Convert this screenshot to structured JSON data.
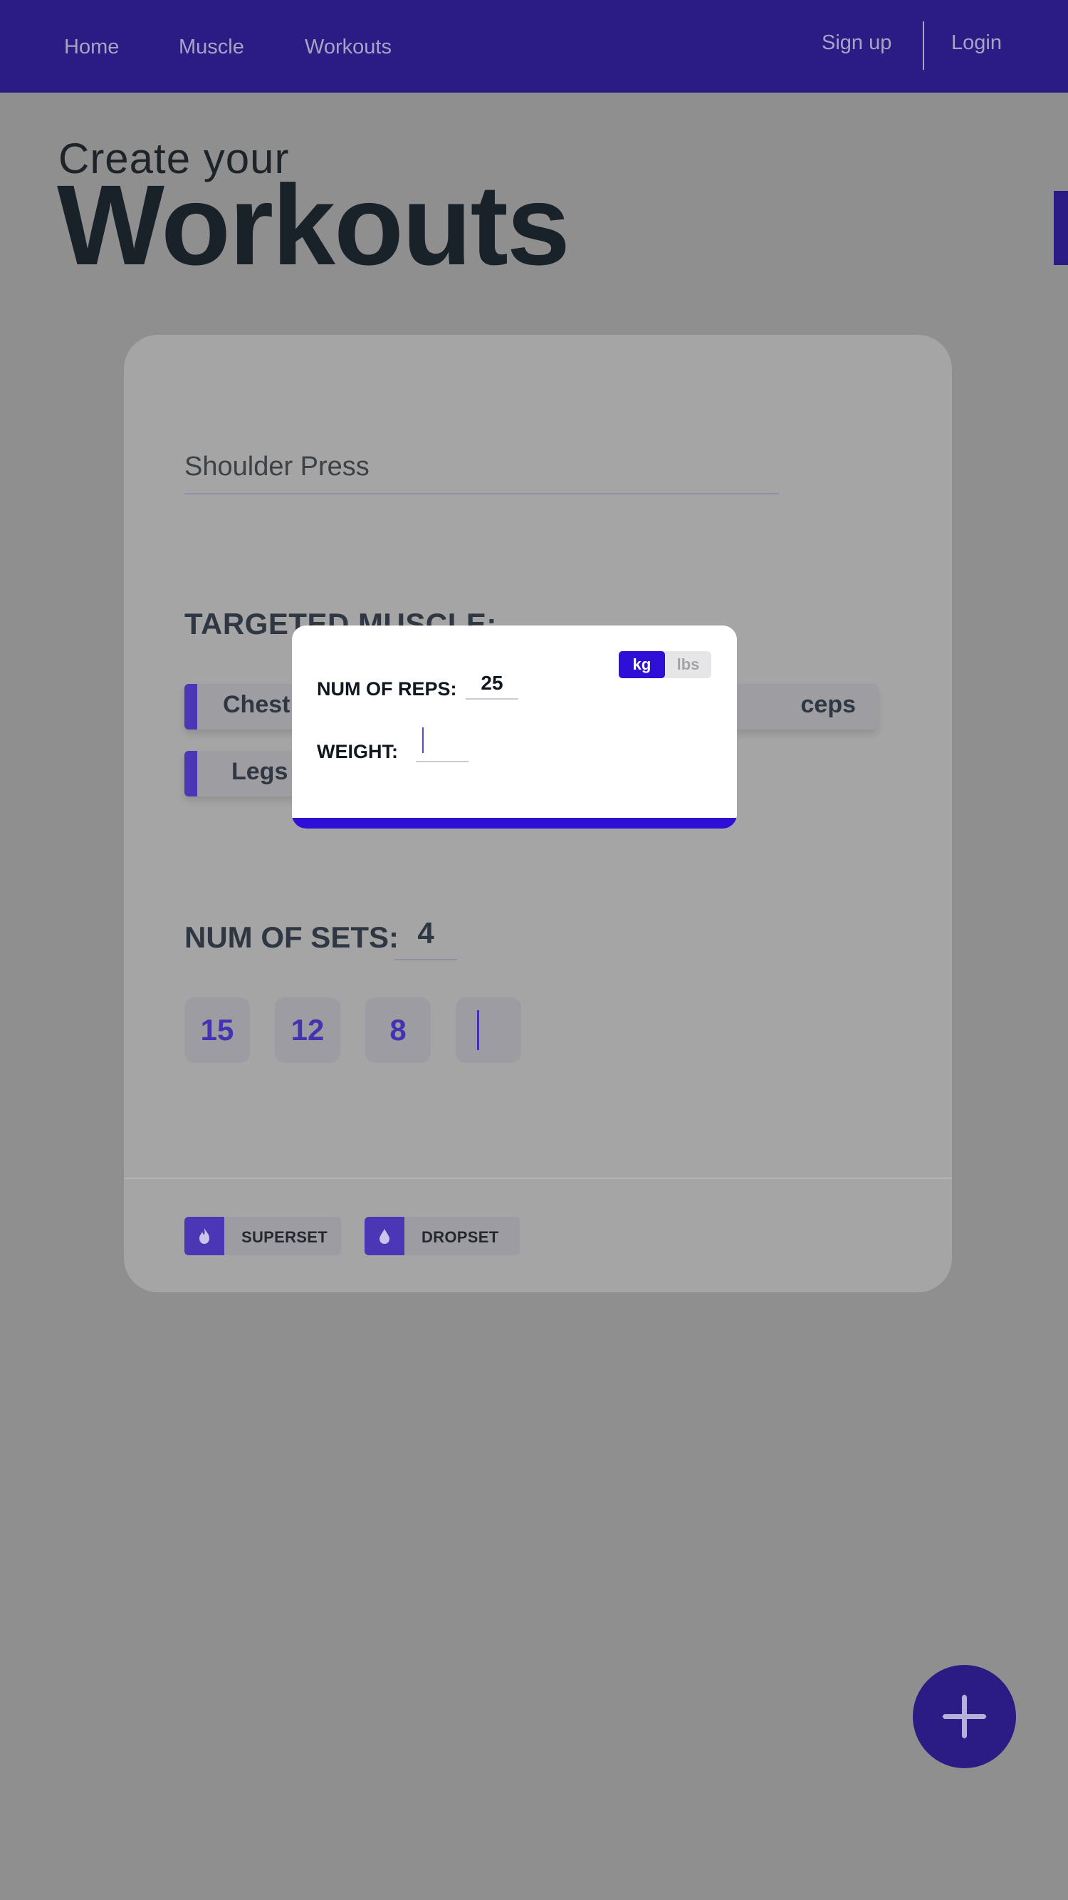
{
  "nav": {
    "home": "Home",
    "muscle": "Muscle",
    "workouts": "Workouts",
    "signup": "Sign up",
    "login": "Login"
  },
  "hero": {
    "subtitle": "Create your",
    "title": "Workouts"
  },
  "card": {
    "exercise_name": "Shoulder Press",
    "targeted_label": "TARGETED MUSCLE:",
    "muscles": {
      "chest": "Chest",
      "legs": "Legs",
      "triceps": "ceps"
    },
    "sets_label": "NUM OF SETS:",
    "sets_value": "4",
    "reps": [
      "15",
      "12",
      "8",
      ""
    ],
    "set_types": {
      "superset": "SUPERSET",
      "dropset": "DROPSET"
    }
  },
  "modal": {
    "reps_label": "NUM OF REPS:",
    "reps_value": "25",
    "weight_label": "WEIGHT:",
    "weight_value": "",
    "unit_kg": "kg",
    "unit_lbs": "lbs",
    "selected_unit": "kg"
  },
  "colors": {
    "nav_bg": "#2a1b85",
    "accent": "#2e0fd6",
    "overlay_bg": "#8f8f8f"
  },
  "icons": {
    "superset": "flame-icon",
    "dropset": "drop-icon",
    "fab": "plus-icon"
  }
}
